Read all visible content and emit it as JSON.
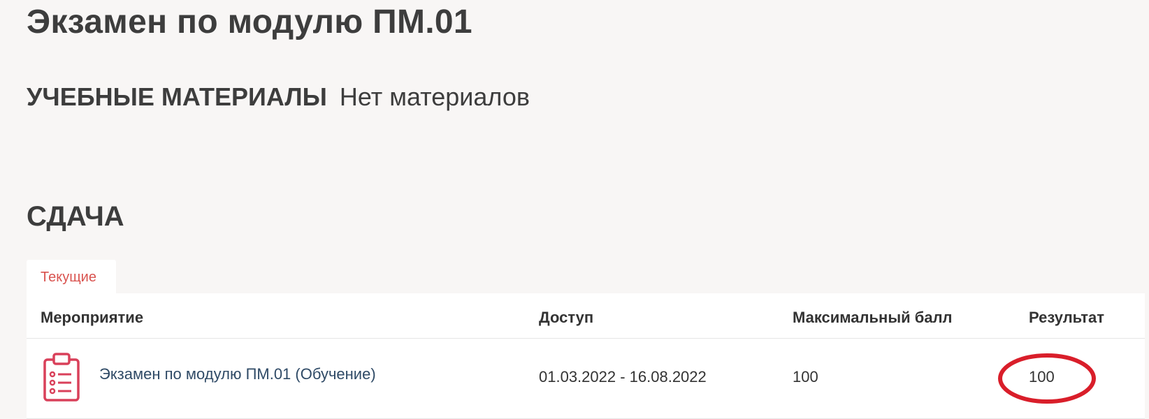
{
  "page": {
    "title": "Экзамен по модулю ПМ.01"
  },
  "materials": {
    "heading": "УЧЕБНЫЕ МАТЕРИАЛЫ",
    "value": "Нет материалов"
  },
  "submission": {
    "heading": "СДАЧА",
    "tabs": [
      {
        "label": "Текущие",
        "active": true
      }
    ],
    "table": {
      "columns": [
        "Мероприятие",
        "Доступ",
        "Максимальный балл",
        "Результат"
      ],
      "rows": [
        {
          "icon": "clipboard-list-icon",
          "event": "Экзамен по модулю ПМ.01 (Обучение)",
          "access": "01.03.2022 - 16.08.2022",
          "max_score": "100",
          "result": "100",
          "result_highlighted": true
        }
      ]
    }
  },
  "colors": {
    "accent": "#d9534f",
    "link": "#2f4a66",
    "icon": "#d9405a",
    "highlight": "#d91e2a",
    "background": "#f8f6f5"
  }
}
